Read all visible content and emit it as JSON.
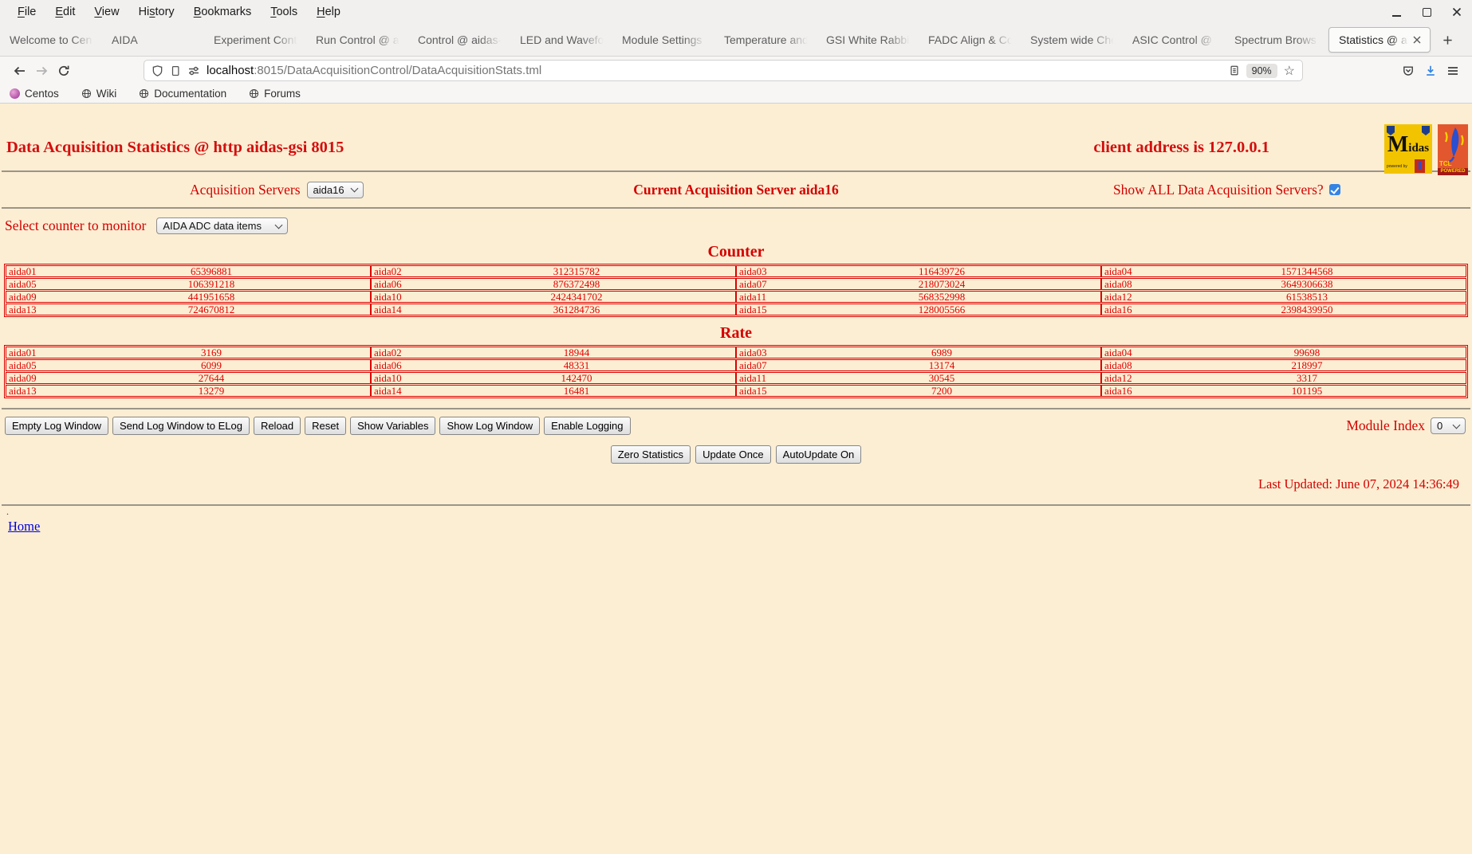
{
  "browser": {
    "menu_items": [
      {
        "label": "File",
        "accel": 0
      },
      {
        "label": "Edit",
        "accel": 0
      },
      {
        "label": "View",
        "accel": 0
      },
      {
        "label": "History",
        "accel": 2
      },
      {
        "label": "Bookmarks",
        "accel": 0
      },
      {
        "label": "Tools",
        "accel": 0
      },
      {
        "label": "Help",
        "accel": 0
      }
    ],
    "tabs": [
      {
        "label": "Welcome to Cen"
      },
      {
        "label": "AIDA"
      },
      {
        "label": "Experiment Cont"
      },
      {
        "label": "Run Control @ a"
      },
      {
        "label": "Control @ aidas-"
      },
      {
        "label": "LED and Wavefo"
      },
      {
        "label": "Module Settings"
      },
      {
        "label": "Temperature and"
      },
      {
        "label": "GSI White Rabbit"
      },
      {
        "label": "FADC Align & Co"
      },
      {
        "label": "System wide Che"
      },
      {
        "label": "ASIC Control @ a"
      },
      {
        "label": "Spectrum Brows"
      },
      {
        "label": "Statistics @ ai",
        "active": true
      }
    ],
    "url_host": "localhost",
    "url_rest": ":8015/DataAcquisitionControl/DataAcquisitionStats.tml",
    "zoom_level": "90%",
    "bookmarks": [
      {
        "label": "Centos",
        "icon": "centos"
      },
      {
        "label": "Wiki",
        "icon": "globe"
      },
      {
        "label": "Documentation",
        "icon": "globe"
      },
      {
        "label": "Forums",
        "icon": "globe"
      }
    ]
  },
  "page": {
    "title": "Data Acquisition Statistics @ http aidas-gsi 8015",
    "client_address": "client address is 127.0.0.1",
    "acquisition_servers_label": "Acquisition Servers",
    "acquisition_server_value": "aida16",
    "current_server_text": "Current Acquisition Server aida16",
    "show_all_label": "Show ALL Data Acquisition Servers?",
    "show_all_checked": true,
    "select_counter_label": "Select counter to monitor",
    "counter_select_value": "AIDA ADC data items",
    "counter_title": "Counter",
    "rate_title": "Rate",
    "counter_rows": [
      [
        [
          "aida01",
          "65396881"
        ],
        [
          "aida02",
          "312315782"
        ],
        [
          "aida03",
          "116439726"
        ],
        [
          "aida04",
          "1571344568"
        ]
      ],
      [
        [
          "aida05",
          "106391218"
        ],
        [
          "aida06",
          "876372498"
        ],
        [
          "aida07",
          "218073024"
        ],
        [
          "aida08",
          "3649306638"
        ]
      ],
      [
        [
          "aida09",
          "441951658"
        ],
        [
          "aida10",
          "2424341702"
        ],
        [
          "aida11",
          "568352998"
        ],
        [
          "aida12",
          "61538513"
        ]
      ],
      [
        [
          "aida13",
          "724670812"
        ],
        [
          "aida14",
          "361284736"
        ],
        [
          "aida15",
          "128005566"
        ],
        [
          "aida16",
          "2398439950"
        ]
      ]
    ],
    "rate_rows": [
      [
        [
          "aida01",
          "3169"
        ],
        [
          "aida02",
          "18944"
        ],
        [
          "aida03",
          "6989"
        ],
        [
          "aida04",
          "99698"
        ]
      ],
      [
        [
          "aida05",
          "6099"
        ],
        [
          "aida06",
          "48331"
        ],
        [
          "aida07",
          "13174"
        ],
        [
          "aida08",
          "218997"
        ]
      ],
      [
        [
          "aida09",
          "27644"
        ],
        [
          "aida10",
          "142470"
        ],
        [
          "aida11",
          "30545"
        ],
        [
          "aida12",
          "3317"
        ]
      ],
      [
        [
          "aida13",
          "13279"
        ],
        [
          "aida14",
          "16481"
        ],
        [
          "aida15",
          "7200"
        ],
        [
          "aida16",
          "101195"
        ]
      ]
    ],
    "log_buttons": [
      "Empty Log Window",
      "Send Log Window to ELog",
      "Reload",
      "Reset",
      "Show Variables",
      "Show Log Window",
      "Enable Logging"
    ],
    "module_index_label": "Module Index",
    "module_index_value": "0",
    "update_buttons": [
      "Zero Statistics",
      "Update Once",
      "AutoUpdate On"
    ],
    "last_updated": "Last Updated: June 07, 2024 14:36:49",
    "dot": ".",
    "home_link": "Home",
    "logos": {
      "midas_text": "Midas",
      "midas_powered": "powered by",
      "tcl_text": "TCL",
      "tcl_powered": "POWERED"
    }
  },
  "colors": {
    "page_background": "#fceed3",
    "accent_red": "#d40000",
    "table_red": "#e00000",
    "link_blue": "#0000dd",
    "checkbox_blue": "#3584e4"
  }
}
